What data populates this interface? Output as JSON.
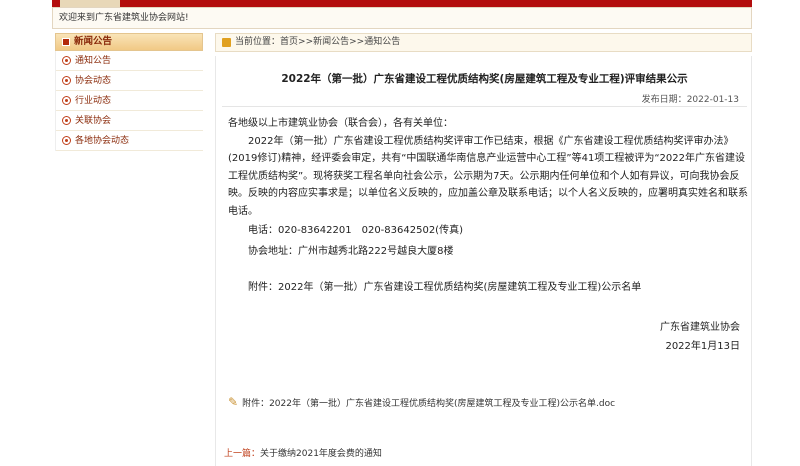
{
  "welcome": "欢迎来到广东省建筑业协会网站!",
  "sidebar": {
    "title": "新闻公告",
    "items": [
      {
        "label": "通知公告"
      },
      {
        "label": "协会动态"
      },
      {
        "label": "行业动态"
      },
      {
        "label": "关联协会"
      },
      {
        "label": "各地协会动态"
      }
    ]
  },
  "breadcrumb": {
    "prefix": "当前位置：",
    "home": "首页",
    "sep1": " >> ",
    "news": "新闻公告",
    "sep2": " >> ",
    "current": "通知公告"
  },
  "article": {
    "title": "2022年（第一批）广东省建设工程优质结构奖(房屋建筑工程及专业工程)评审结果公示",
    "date_label": "发布日期：",
    "date": "2022-01-13",
    "salutation": "各地级以上市建筑业协会（联合会），各有关单位：",
    "paragraph": "2022年（第一批）广东省建设工程优质结构奖评审工作已结束，根据《广东省建设工程优质结构奖评审办法》(2019修订)精神，经评委会审定，共有“中国联通华南信息产业运营中心工程”等41项工程被评为“2022年广东省建设工程优质结构奖”。现将获奖工程名单向社会公示，公示期为7天。公示期内任何单位和个人如有异议，可向我协会反映。反映的内容应实事求是；以单位名义反映的，应加盖公章及联系电话；以个人名义反映的，应署明真实姓名和联系电话。",
    "phone": "电话：020-83642201　020-83642502(传真)",
    "address": "协会地址：广州市越秀北路222号越良大厦8楼",
    "attachment_text": "附件：2022年（第一批）广东省建设工程优质结构奖(房屋建筑工程及专业工程)公示名单",
    "signature": "广东省建筑业协会",
    "sign_date": "2022年1月13日",
    "attachment_file": "附件：2022年（第一批）广东省建设工程优质结构奖(房屋建筑工程及专业工程)公示名单.doc",
    "prev_label": "上一篇：",
    "prev_title": "关于缴纳2021年度会费的通知"
  },
  "colors": {
    "accent": "#b30d0d",
    "sidebar_link": "#8a2a0a"
  }
}
